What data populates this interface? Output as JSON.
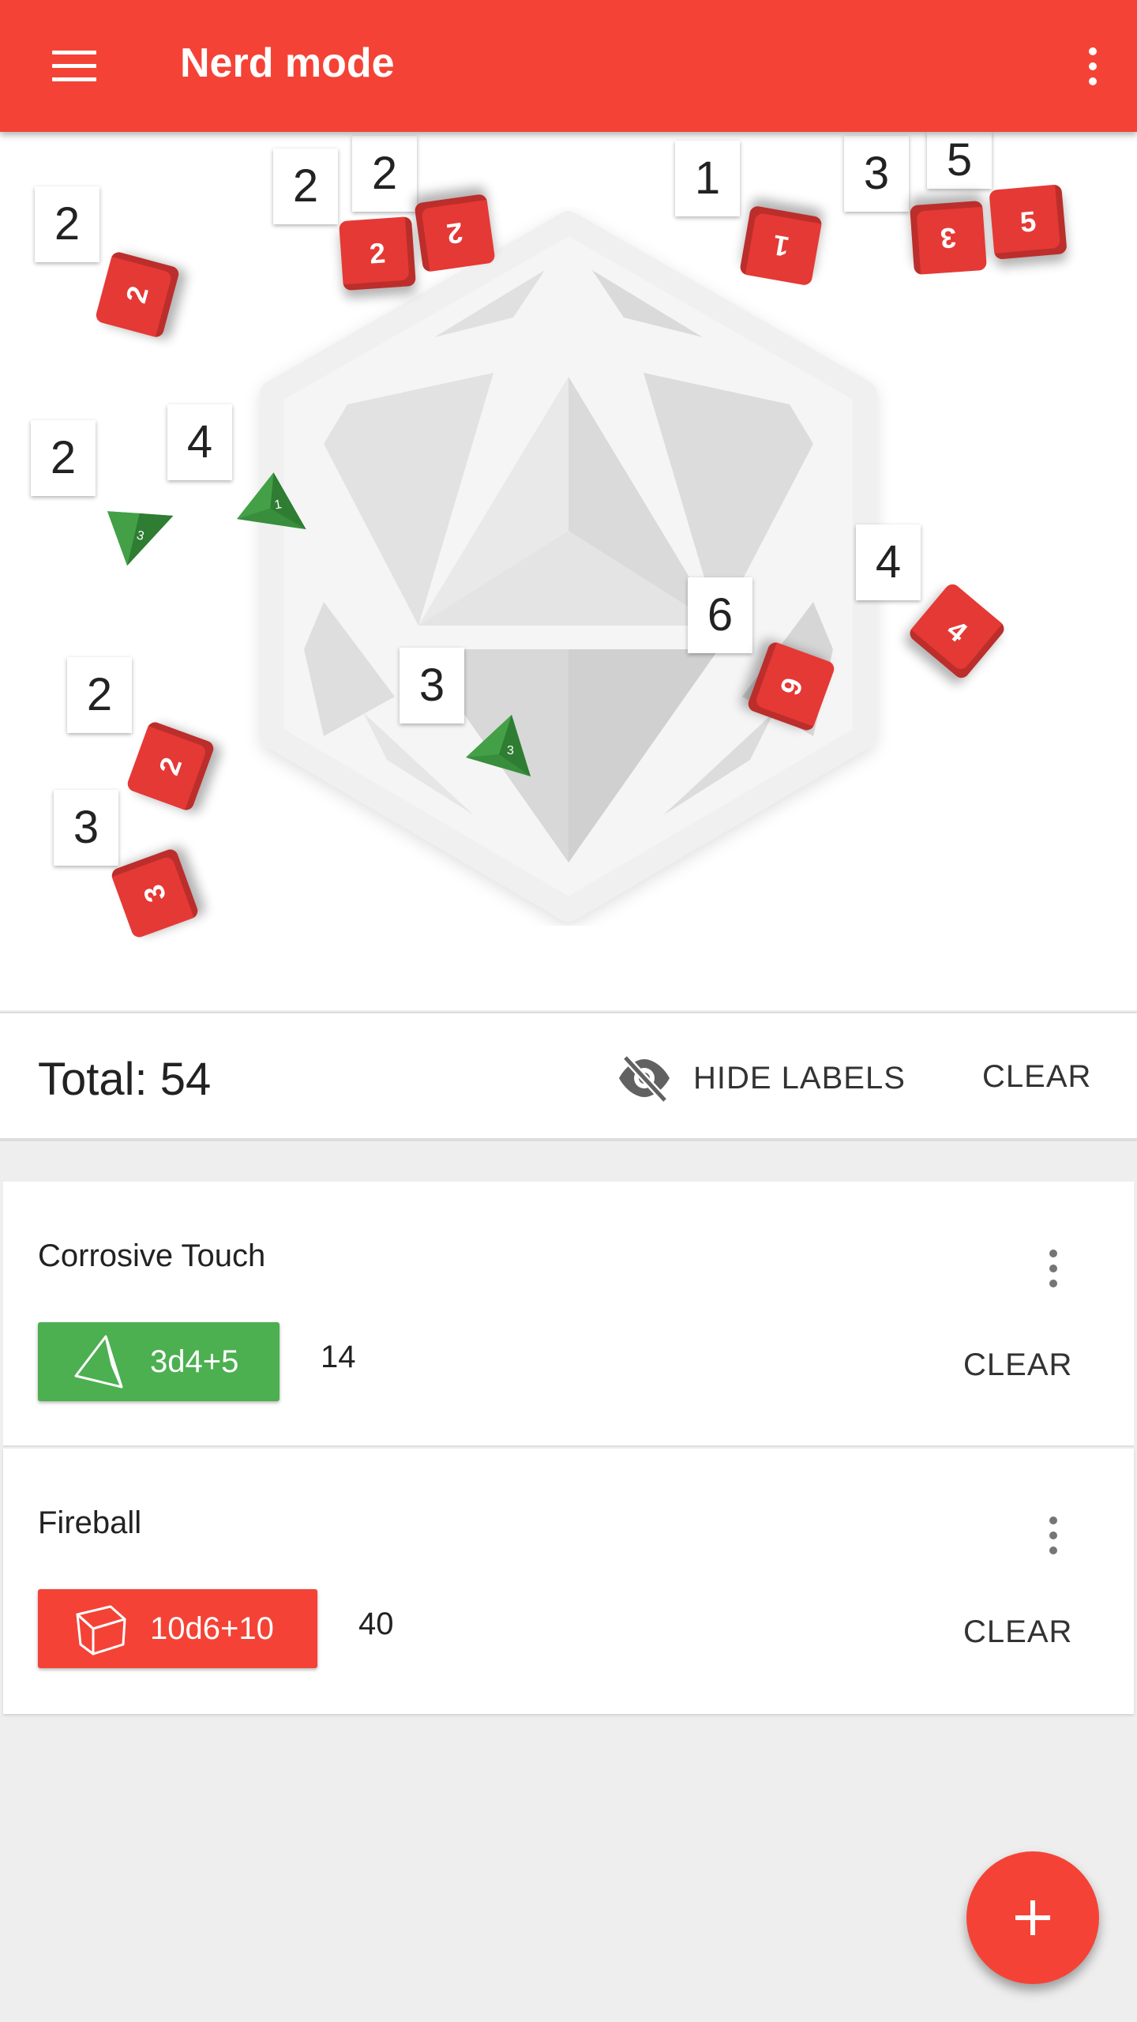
{
  "app_bar": {
    "title": "Nerd mode",
    "menu_icon": "hamburger-menu-icon",
    "overflow_icon": "more-vert-icon",
    "color": "#f44336"
  },
  "dice_area": {
    "background_icon": "d20-icon",
    "labels": [
      "2",
      "2",
      "2",
      "1",
      "3",
      "5",
      "2",
      "4",
      "4",
      "6",
      "2",
      "3",
      "3"
    ],
    "d6_faces": [
      "2",
      "2",
      "2",
      "1",
      "3",
      "5",
      "4",
      "6",
      "2",
      "3"
    ],
    "d4_faces": [
      "3",
      "1",
      "3"
    ],
    "d6_color": "#e53935",
    "d4_color": "#388e3c"
  },
  "total_bar": {
    "total_label": "Total: 54",
    "hide_labels_label": "HIDE LABELS",
    "hide_labels_icon": "eye-off-icon",
    "clear_label": "CLEAR"
  },
  "cards": [
    {
      "title": "Corrosive Touch",
      "dice_expression": "3d4+5",
      "dice_icon": "d4-tetrahedron-icon",
      "result": "14",
      "clear_label": "CLEAR",
      "color": "#4caf50"
    },
    {
      "title": "Fireball",
      "dice_expression": "10d6+10",
      "dice_icon": "d6-cube-icon",
      "result": "40",
      "clear_label": "CLEAR",
      "color": "#f44336"
    }
  ],
  "fab": {
    "icon": "plus-icon",
    "label": "+"
  }
}
